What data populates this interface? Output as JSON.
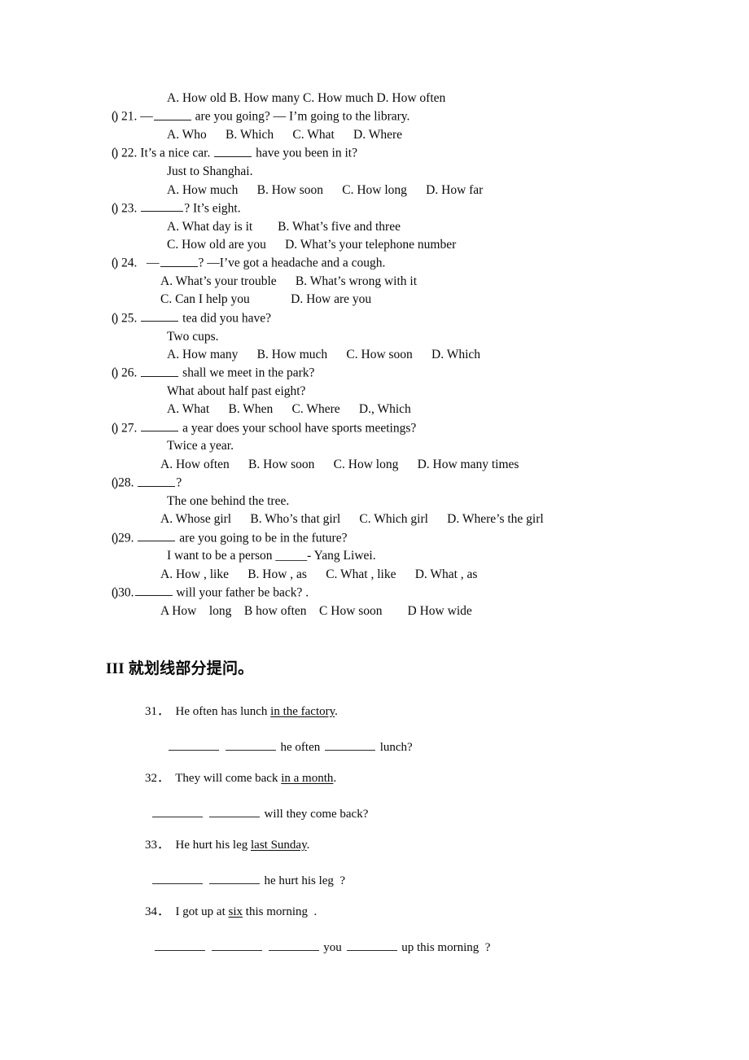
{
  "document": {
    "language": "en-zh",
    "paper_type": "english-grammar-worksheet"
  },
  "multiple_choice": {
    "orphan_options_line": "A. How old      B. How many      C. How much      D. How often",
    "questions": [
      {
        "paren": "(",
        "number": ") 21.",
        "stem_before_blank": " —",
        "stem_after_blank": " are you going? — I’m going to the library.",
        "sub_line": "",
        "options_lines": [
          "A. Who      B. Which      C. What      D. Where"
        ]
      },
      {
        "paren": "(",
        "number": ") 22.",
        "stem_before_blank": " It’s a nice car. ",
        "stem_after_blank": " have you been in it?",
        "sub_line": "Just to Shanghai.",
        "options_lines": [
          "A. How much      B. How soon      C. How long      D. How far"
        ]
      },
      {
        "paren": "(",
        "number": ") 23.",
        "stem_before_blank": " ",
        "stem_after_blank": "? It’s eight.",
        "sub_line": "",
        "options_lines": [
          "A. What day is it        B. What’s five and three",
          "C. How old are you      D. What’s your telephone number"
        ]
      },
      {
        "paren": "(",
        "number": ") 24.",
        "stem_before_blank": "   —",
        "stem_after_blank": "? —I’ve got a headache and a cough.",
        "sub_line": "",
        "options_lines": [
          "A. What’s your trouble      B. What’s wrong with it",
          "C. Can I help you             D. How are you"
        ]
      },
      {
        "paren": "(",
        "number": ") 25.",
        "stem_before_blank": " ",
        "stem_after_blank": " tea did you have?",
        "sub_line": "Two cups.",
        "options_lines": [
          "A. How many      B. How much      C. How soon      D. Which"
        ]
      },
      {
        "paren": "(",
        "number": ") 26.",
        "stem_before_blank": " ",
        "stem_after_blank": " shall we meet in the park?",
        "sub_line": "What about half past eight?",
        "options_lines": [
          "A. What      B. When      C. Where      D., Which"
        ]
      },
      {
        "paren": "(",
        "number": ") 27.",
        "stem_before_blank": " ",
        "stem_after_blank": " a year does your school have sports meetings?",
        "sub_line": "Twice a year.",
        "options_lines": [
          "A. How often      B. How soon      C. How long      D. How many times"
        ]
      },
      {
        "paren": "(",
        "number": ")28.",
        "stem_before_blank": " ",
        "stem_after_blank": "?",
        "sub_line": "The one behind the tree.",
        "options_lines": [
          "A. Whose girl      B. Who’s that girl      C. Which girl      D. Where’s the girl"
        ]
      },
      {
        "paren": "(",
        "number": ")29.",
        "stem_before_blank": " ",
        "stem_after_blank": " are you going to be in the future?",
        "sub_line": "I want to be a person _____- Yang Liwei.",
        "options_lines": [
          "A. How , like      B. How , as      C. What , like      D. What , as"
        ]
      },
      {
        "paren": "(",
        "number": ")30.",
        "stem_before_blank": "",
        "stem_after_blank": " will your father be back? .",
        "sub_line": "",
        "options_lines": [
          "A How    long    B how often    C How soon        D How wide"
        ]
      }
    ]
  },
  "section_three": {
    "roman": "III",
    "title": "就划线部分提问。",
    "items": [
      {
        "number": "31．",
        "prompt_before": "He often has lunch ",
        "prompt_underlined": "in the factory",
        "prompt_after": ".",
        "answer_parts": [
          "",
          "",
          " he often ",
          " lunch?"
        ]
      },
      {
        "number": "32．",
        "prompt_before": "They will come back ",
        "prompt_underlined": "in a month",
        "prompt_after": ".",
        "answer_parts": [
          "",
          "",
          " will they come back?"
        ]
      },
      {
        "number": "33．",
        "prompt_before": "He hurt his leg ",
        "prompt_underlined": "last Sunday",
        "prompt_after": ".",
        "answer_parts": [
          "",
          "",
          " he hurt his leg  ?"
        ]
      },
      {
        "number": "34．",
        "prompt_before": "I got up at ",
        "prompt_underlined": "six",
        "prompt_after": " this morning  .",
        "answer_parts": [
          "",
          "",
          "",
          " you ",
          " up this morning  ?"
        ]
      }
    ]
  }
}
